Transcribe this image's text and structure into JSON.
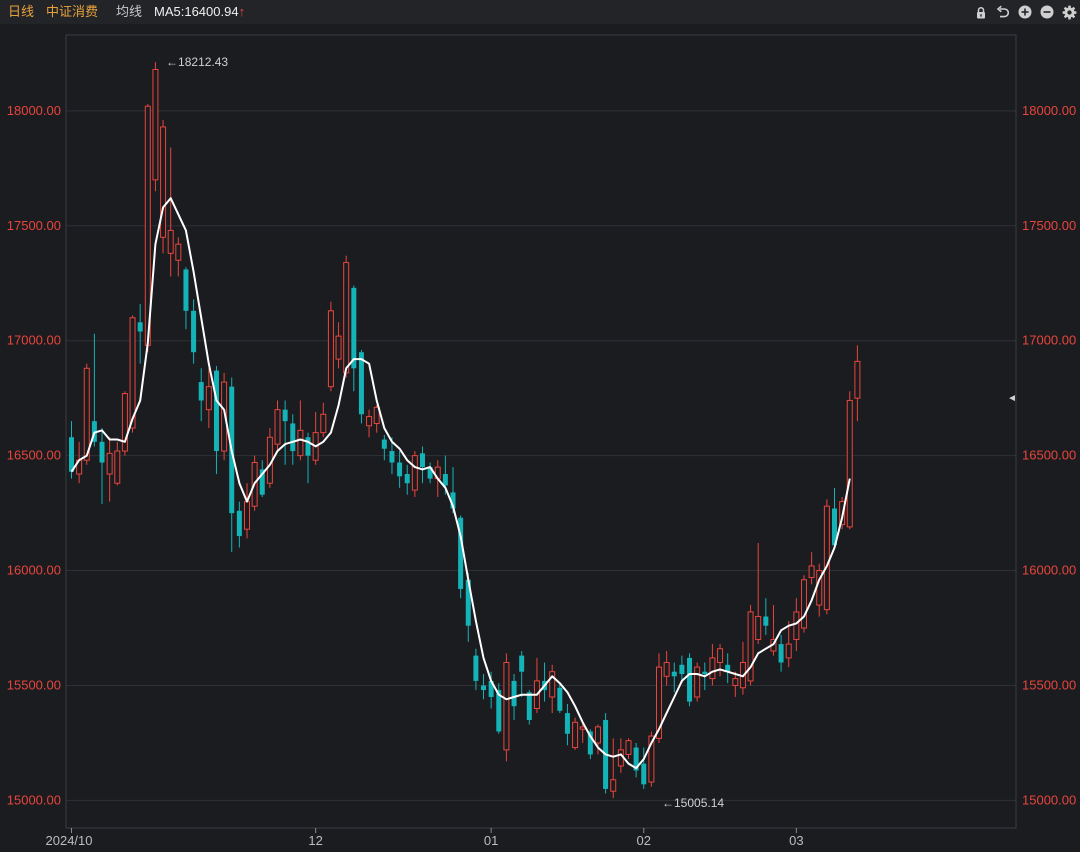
{
  "toolbar": {
    "period": "日线",
    "index_name": "中证消费",
    "ma_label": "均线",
    "ma5_text": "MA5:16400.94",
    "ma5_arrow": "↑"
  },
  "icons": [
    "lock-icon",
    "undo-icon",
    "zoom-in-icon",
    "zoom-out-icon",
    "gear-icon"
  ],
  "colors": {
    "background": "#1b1c20",
    "up": "#e8453c",
    "down": "#14b3b8",
    "ma5_line": "#ffffff",
    "axis_text": "#e8453c",
    "grid": "#2e3036",
    "label_period": "#e8a23c"
  },
  "chart_data": {
    "type": "candlestick",
    "ylim": [
      14880,
      18330
    ],
    "y_ticks": [
      "18000.00",
      "17500.00",
      "17000.00",
      "16500.00",
      "16000.00",
      "15500.00",
      "15000.00"
    ],
    "x_tick_labels": [
      {
        "label": "2024/10",
        "index": 0
      },
      {
        "label": "12",
        "index": 32
      },
      {
        "label": "01",
        "index": 55
      },
      {
        "label": "02",
        "index": 75
      },
      {
        "label": "03",
        "index": 95
      }
    ],
    "annotations": [
      {
        "text": "←18212.43",
        "index": 12,
        "value": 18212.43
      },
      {
        "text": "←15005.14",
        "index": 77,
        "value": 15005.14
      }
    ],
    "current_price_marker": 16750,
    "candles": [
      [
        16580,
        16430,
        16650,
        16400
      ],
      [
        16420,
        16480,
        16560,
        16380
      ],
      [
        16480,
        16880,
        16900,
        16460
      ],
      [
        16650,
        16560,
        17030,
        16540
      ],
      [
        16560,
        16470,
        16620,
        16290
      ],
      [
        16420,
        16510,
        16580,
        16300
      ],
      [
        16380,
        16520,
        16560,
        16370
      ],
      [
        16520,
        16770,
        16780,
        16500
      ],
      [
        16620,
        17100,
        17110,
        16600
      ],
      [
        17080,
        17040,
        17160,
        16900
      ],
      [
        16980,
        18020,
        18030,
        16950
      ],
      [
        17700,
        18180,
        18212,
        17650
      ],
      [
        17450,
        17930,
        17960,
        17380
      ],
      [
        17380,
        17480,
        17840,
        17280
      ],
      [
        17350,
        17420,
        17450,
        17280
      ],
      [
        17310,
        17130,
        17320,
        17050
      ],
      [
        17130,
        16950,
        17180,
        16900
      ],
      [
        16820,
        16740,
        16880,
        16650
      ],
      [
        16700,
        16800,
        16880,
        16620
      ],
      [
        16870,
        16520,
        16890,
        16420
      ],
      [
        16520,
        16820,
        16860,
        16480
      ],
      [
        16800,
        16250,
        16840,
        16080
      ],
      [
        16260,
        16150,
        16300,
        16100
      ],
      [
        16180,
        16300,
        16380,
        16140
      ],
      [
        16280,
        16470,
        16500,
        16260
      ],
      [
        16440,
        16330,
        16480,
        16320
      ],
      [
        16380,
        16580,
        16620,
        16360
      ],
      [
        16550,
        16700,
        16740,
        16520
      ],
      [
        16700,
        16650,
        16740,
        16460
      ],
      [
        16640,
        16520,
        16680,
        16460
      ],
      [
        16500,
        16610,
        16740,
        16480
      ],
      [
        16580,
        16500,
        16600,
        16380
      ],
      [
        16480,
        16600,
        16690,
        16460
      ],
      [
        16600,
        16680,
        16730,
        16580
      ],
      [
        16800,
        17130,
        17170,
        16780
      ],
      [
        16920,
        17020,
        17080,
        16880
      ],
      [
        16860,
        17340,
        17370,
        16840
      ],
      [
        17230,
        16880,
        17240,
        16780
      ],
      [
        16950,
        16680,
        16960,
        16640
      ],
      [
        16630,
        16670,
        16700,
        16580
      ],
      [
        16640,
        16710,
        16720,
        16600
      ],
      [
        16570,
        16530,
        16590,
        16480
      ],
      [
        16520,
        16470,
        16580,
        16420
      ],
      [
        16470,
        16410,
        16520,
        16360
      ],
      [
        16420,
        16380,
        16460,
        16330
      ],
      [
        16350,
        16500,
        16520,
        16320
      ],
      [
        16510,
        16450,
        16540,
        16380
      ],
      [
        16450,
        16400,
        16470,
        16380
      ],
      [
        16400,
        16450,
        16480,
        16320
      ],
      [
        16420,
        16370,
        16500,
        16330
      ],
      [
        16340,
        16270,
        16450,
        16250
      ],
      [
        16230,
        15920,
        16240,
        15880
      ],
      [
        15960,
        15760,
        15990,
        15690
      ],
      [
        15630,
        15520,
        15660,
        15480
      ],
      [
        15500,
        15480,
        15550,
        15440
      ],
      [
        15520,
        15450,
        15560,
        15400
      ],
      [
        15480,
        15300,
        15510,
        15290
      ],
      [
        15220,
        15600,
        15640,
        15170
      ],
      [
        15520,
        15410,
        15550,
        15350
      ],
      [
        15630,
        15560,
        15650,
        15450
      ],
      [
        15470,
        15350,
        15480,
        15330
      ],
      [
        15400,
        15520,
        15620,
        15380
      ],
      [
        15520,
        15480,
        15600,
        15430
      ],
      [
        15450,
        15560,
        15590,
        15380
      ],
      [
        15490,
        15390,
        15510,
        15380
      ],
      [
        15380,
        15290,
        15420,
        15240
      ],
      [
        15230,
        15340,
        15360,
        15220
      ],
      [
        15310,
        15320,
        15340,
        15250
      ],
      [
        15300,
        15200,
        15310,
        15180
      ],
      [
        15250,
        15320,
        15330,
        15200
      ],
      [
        15350,
        15050,
        15380,
        15030
      ],
      [
        15040,
        15090,
        15270,
        15010
      ],
      [
        15150,
        15220,
        15270,
        15120
      ],
      [
        15200,
        15260,
        15270,
        15180
      ],
      [
        15230,
        15130,
        15250,
        15100
      ],
      [
        15160,
        15070,
        15230,
        15050
      ],
      [
        15080,
        15280,
        15300,
        15060
      ],
      [
        15270,
        15580,
        15640,
        15250
      ],
      [
        15540,
        15600,
        15650,
        15500
      ],
      [
        15560,
        15540,
        15600,
        15470
      ],
      [
        15590,
        15550,
        15630,
        15510
      ],
      [
        15620,
        15430,
        15640,
        15410
      ],
      [
        15450,
        15580,
        15600,
        15430
      ],
      [
        15560,
        15550,
        15600,
        15480
      ],
      [
        15530,
        15620,
        15680,
        15500
      ],
      [
        15600,
        15660,
        15680,
        15540
      ],
      [
        15590,
        15560,
        15640,
        15510
      ],
      [
        15500,
        15530,
        15560,
        15450
      ],
      [
        15490,
        15600,
        15690,
        15460
      ],
      [
        15520,
        15820,
        15850,
        15500
      ],
      [
        15700,
        15800,
        16120,
        15680
      ],
      [
        15800,
        15760,
        15880,
        15720
      ],
      [
        15650,
        15700,
        15850,
        15630
      ],
      [
        15680,
        15600,
        15720,
        15560
      ],
      [
        15620,
        15680,
        15780,
        15580
      ],
      [
        15700,
        15820,
        15880,
        15650
      ],
      [
        15750,
        15960,
        15980,
        15730
      ],
      [
        15970,
        16020,
        16080,
        15940
      ],
      [
        15850,
        16000,
        16030,
        15800
      ],
      [
        15830,
        16280,
        16310,
        15810
      ],
      [
        16270,
        16110,
        16360,
        16100
      ],
      [
        16200,
        16300,
        16320,
        16180
      ],
      [
        16190,
        16740,
        16780,
        16180
      ],
      [
        16750,
        16910,
        16980,
        16650
      ]
    ],
    "ma5": [
      16430,
      16480,
      16500,
      16600,
      16610,
      16570,
      16570,
      16560,
      16660,
      16740,
      16990,
      17420,
      17580,
      17620,
      17550,
      17480,
      17300,
      17100,
      16900,
      16740,
      16700,
      16520,
      16380,
      16300,
      16380,
      16420,
      16460,
      16520,
      16550,
      16560,
      16570,
      16560,
      16540,
      16560,
      16600,
      16720,
      16880,
      16920,
      16920,
      16900,
      16740,
      16620,
      16560,
      16530,
      16480,
      16450,
      16440,
      16450,
      16400,
      16360,
      16280,
      16150,
      15960,
      15780,
      15620,
      15520,
      15460,
      15440,
      15450,
      15460,
      15460,
      15460,
      15500,
      15540,
      15510,
      15470,
      15410,
      15340,
      15280,
      15230,
      15200,
      15190,
      15200,
      15160,
      15140,
      15180,
      15250,
      15310,
      15380,
      15450,
      15520,
      15550,
      15550,
      15540,
      15560,
      15570,
      15560,
      15550,
      15540,
      15580,
      15640,
      15660,
      15680,
      15740,
      15760,
      15770,
      15800,
      15870,
      15960,
      16020,
      16100,
      16230,
      16400
    ]
  }
}
